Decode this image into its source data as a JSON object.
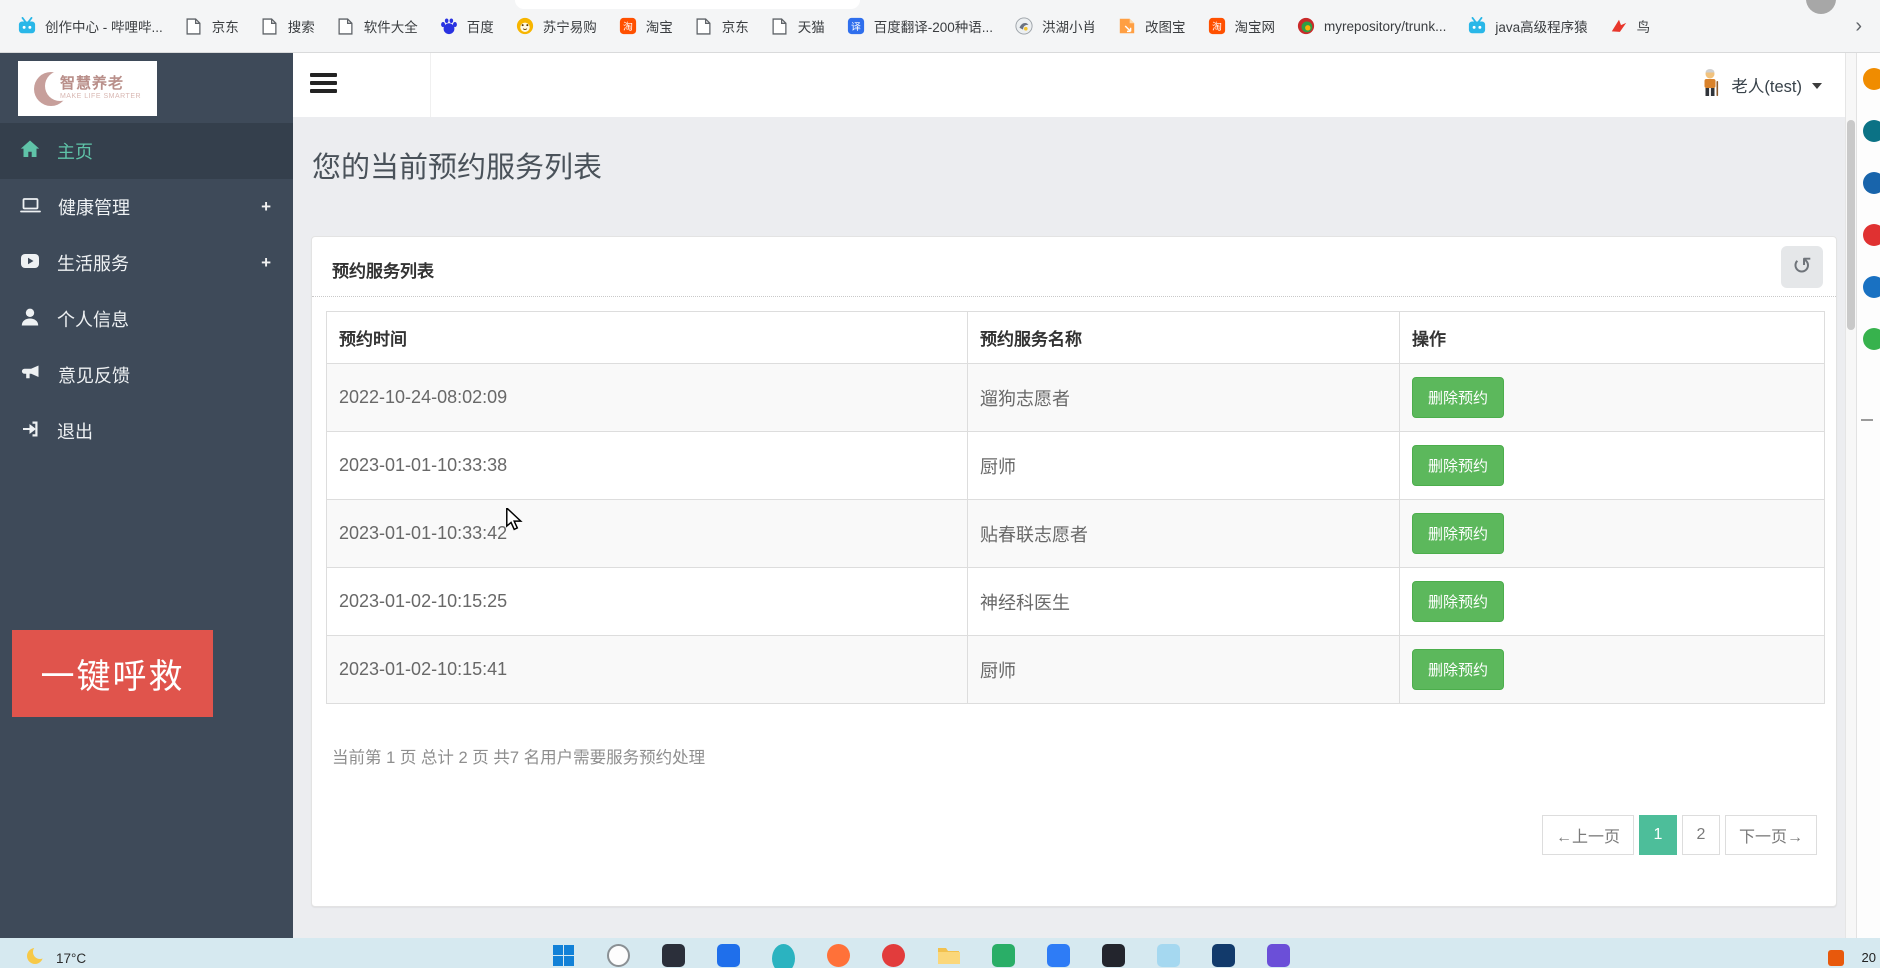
{
  "browser": {
    "bookmarks": [
      {
        "label": "创作中心 - 哔哩哔...",
        "icon": "bilibili-icon"
      },
      {
        "label": "京东",
        "icon": "page-icon"
      },
      {
        "label": "搜索",
        "icon": "page-icon"
      },
      {
        "label": "软件大全",
        "icon": "page-icon"
      },
      {
        "label": "百度",
        "icon": "baidu-icon"
      },
      {
        "label": "苏宁易购",
        "icon": "lion-icon"
      },
      {
        "label": "淘宝",
        "icon": "taobao-icon"
      },
      {
        "label": "京东",
        "icon": "page-icon"
      },
      {
        "label": "天猫",
        "icon": "page-icon"
      },
      {
        "label": "百度翻译-200种语...",
        "icon": "translate-icon"
      },
      {
        "label": "洪湖小肖",
        "icon": "bird-gray-icon"
      },
      {
        "label": "改图宝",
        "icon": "image-edit-icon"
      },
      {
        "label": "淘宝网",
        "icon": "taobao-icon"
      },
      {
        "label": "myrepository/trunk...",
        "icon": "repo-sphere-icon"
      },
      {
        "label": "java高级程序猿",
        "icon": "bilibili-icon"
      },
      {
        "label": "鸟",
        "icon": "bird-red-icon"
      }
    ],
    "overflow_chevron": "›"
  },
  "sidebar": {
    "logo": {
      "title": "智慧养老",
      "subtitle": "MAKE LIFE SMARTER"
    },
    "items": [
      {
        "label": "主页",
        "icon": "home-icon",
        "active": true
      },
      {
        "label": "健康管理",
        "icon": "monitor-icon",
        "plus": "+"
      },
      {
        "label": "生活服务",
        "icon": "video-icon",
        "plus": "+"
      },
      {
        "label": "个人信息",
        "icon": "user-icon"
      },
      {
        "label": "意见反馈",
        "icon": "megaphone-icon"
      },
      {
        "label": "退出",
        "icon": "signout-icon"
      }
    ],
    "sos_label": "一键呼救"
  },
  "header": {
    "user_name": "老人(test)"
  },
  "main": {
    "page_title": "您的当前预约服务列表",
    "panel": {
      "title": "预约服务列表",
      "refresh_glyph": "↺",
      "table": {
        "columns": [
          "预约时间",
          "预约服务名称",
          "操作"
        ],
        "action_label": "删除预约",
        "rows": [
          {
            "time": "2022-10-24-08:02:09",
            "service": "遛狗志愿者"
          },
          {
            "time": "2023-01-01-10:33:38",
            "service": "厨师"
          },
          {
            "time": "2023-01-01-10:33:42",
            "service": "贴春联志愿者"
          },
          {
            "time": "2023-01-02-10:15:25",
            "service": "神经科医生"
          },
          {
            "time": "2023-01-02-10:15:41",
            "service": "厨师"
          }
        ]
      },
      "summary": "当前第 1 页 总计 2 页 共7 名用户需要服务预约处理",
      "pagination": [
        {
          "label": "←上一页",
          "type": "prev"
        },
        {
          "label": "1",
          "type": "page",
          "active": true
        },
        {
          "label": "2",
          "type": "page"
        },
        {
          "label": "下一页→",
          "type": "next"
        }
      ]
    }
  },
  "taskbar": {
    "weather_temp": "17°C",
    "clock": "20",
    "icons": [
      {
        "name": "windows-start-icon",
        "color": "#1281d7",
        "shape": "windows"
      },
      {
        "name": "search-icon",
        "color": "#fdfdfd",
        "shape": "circle-outline"
      },
      {
        "name": "app-dark-icon",
        "color": "#2b2f3a",
        "shape": "square"
      },
      {
        "name": "app-blue-icon",
        "color": "#1f6feb",
        "shape": "square"
      },
      {
        "name": "edge-browser-icon",
        "color": "#2bb3c0",
        "shape": "circle-big"
      },
      {
        "name": "firefox-icon",
        "color": "#ff7139",
        "shape": "circle"
      },
      {
        "name": "app-red-icon",
        "color": "#e23c3c",
        "shape": "circle"
      },
      {
        "name": "folder-icon",
        "color": "#f2c14e",
        "shape": "folder"
      },
      {
        "name": "wechat-icon",
        "color": "#2aae67",
        "shape": "square"
      },
      {
        "name": "app-blue2-icon",
        "color": "#2e7cf6",
        "shape": "square"
      },
      {
        "name": "app-black-icon",
        "color": "#23252d",
        "shape": "square"
      },
      {
        "name": "app-lightblue-icon",
        "color": "#a5d8f0",
        "shape": "square"
      },
      {
        "name": "app-navy-icon",
        "color": "#123a6b",
        "shape": "square"
      },
      {
        "name": "app-purple-icon",
        "color": "#6b4fd8",
        "shape": "square"
      }
    ]
  },
  "extensions_strip": {
    "icons": [
      {
        "name": "ext-orange-icon",
        "color": "#f08c00"
      },
      {
        "name": "ext-teal-icon",
        "color": "#0b7285"
      },
      {
        "name": "ext-blue-icon",
        "color": "#1864ab"
      },
      {
        "name": "ext-red-icon",
        "color": "#e03131"
      },
      {
        "name": "ext-blue2-icon",
        "color": "#1971c2"
      },
      {
        "name": "ext-green-icon",
        "color": "#37b24d"
      }
    ]
  },
  "colors": {
    "sidebar_bg": "#3e4a59",
    "sidebar_active_text": "#5fc3a8",
    "accent_button_green": "#5cb85c",
    "pagination_active": "#4dbe9a",
    "sos_red": "#e0544c",
    "content_bg": "#ecedf0",
    "taskbar_bg": "#d6e9f0"
  }
}
